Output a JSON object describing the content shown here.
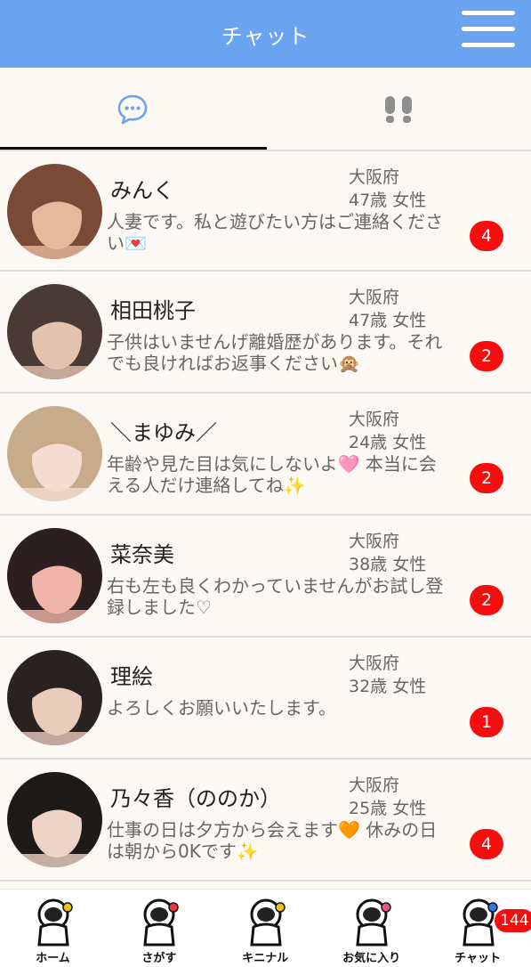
{
  "header": {
    "title": "チャット"
  },
  "tabs": [
    {
      "name": "chat",
      "icon": "chat-bubble-icon"
    },
    {
      "name": "footprints",
      "icon": "footprints-icon"
    }
  ],
  "chats": [
    {
      "name": "みんく",
      "prefecture": "大阪府",
      "age_gender": "47歳 女性",
      "message": "人妻です。私と遊びたい方はご連絡ください💌",
      "unread": "4",
      "avatar_colors": [
        "#7a4a37",
        "#e8b89c"
      ]
    },
    {
      "name": "相田桃子",
      "prefecture": "大阪府",
      "age_gender": "47歳 女性",
      "message": "子供はいませんげ離婚歴があります。それでも良ければお返事ください🙊",
      "unread": "2",
      "avatar_colors": [
        "#4b3a34",
        "#e3c3b0"
      ]
    },
    {
      "name": "＼まゆみ／",
      "prefecture": "大阪府",
      "age_gender": "24歳 女性",
      "message": "年齢や見た目は気にしないよ🩷 本当に会える人だけ連絡してね✨",
      "unread": "2",
      "avatar_colors": [
        "#c8ab8a",
        "#f3ddd0"
      ]
    },
    {
      "name": "菜奈美",
      "prefecture": "大阪府",
      "age_gender": "38歳 女性",
      "message": "右も左も良くわかっていませんがお試し登録しました♡",
      "unread": "2",
      "avatar_colors": [
        "#2d1f1f",
        "#f0b5a8"
      ]
    },
    {
      "name": "理絵",
      "prefecture": "大阪府",
      "age_gender": "32歳 女性",
      "message": "よろしくお願いいたします。",
      "unread": "1",
      "avatar_colors": [
        "#2a2220",
        "#e9cbbb"
      ]
    },
    {
      "name": "乃々香（ののか）",
      "prefecture": "大阪府",
      "age_gender": "25歳 女性",
      "message": "仕事の日は夕方から会えます🧡 休みの日は朝から0Kです✨",
      "unread": "4",
      "avatar_colors": [
        "#1f1a1a",
        "#eed4c6"
      ]
    }
  ],
  "bottom_nav": [
    {
      "label": "ホーム",
      "icon": "astronaut-moon-icon"
    },
    {
      "label": "さがす",
      "icon": "astronaut-rocket-icon"
    },
    {
      "label": "キニナル",
      "icon": "astronaut-star-icon"
    },
    {
      "label": "お気に入り",
      "icon": "astronaut-heart-icon"
    },
    {
      "label": "チャット",
      "icon": "astronaut-chat-icon",
      "badge": "144"
    }
  ],
  "colors": {
    "header": "#6aa3ef",
    "badge": "#f60d0d",
    "background": "#fcf9f4"
  }
}
